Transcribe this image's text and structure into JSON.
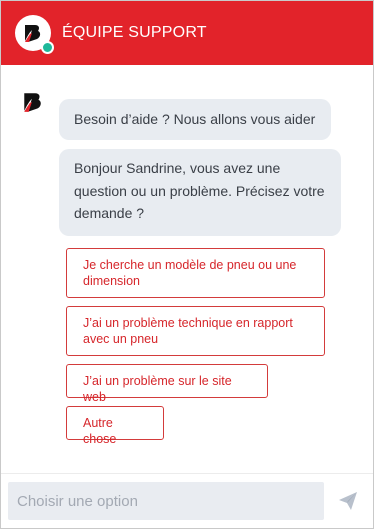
{
  "header": {
    "title": "ÉQUIPE SUPPORT",
    "avatar_icon": "bridgestone-logo-icon",
    "status_color": "#1fb89a"
  },
  "brand": {
    "accent": "#e2232a"
  },
  "messages": [
    {
      "text": "Besoin d’aide ? Nous allons vous aider"
    },
    {
      "text": "Bonjour Sandrine, vous avez une question ou un problème. Précisez votre demande ?"
    }
  ],
  "options": [
    {
      "label": "Je cherche un modèle de pneu ou une dimension"
    },
    {
      "label": "J’ai un problème technique en rapport avec un pneu"
    },
    {
      "label": "J’ai un problème sur le site web"
    },
    {
      "label": "Autre chose"
    }
  ],
  "composer": {
    "placeholder": "Choisir une option",
    "send_icon": "send-icon"
  }
}
